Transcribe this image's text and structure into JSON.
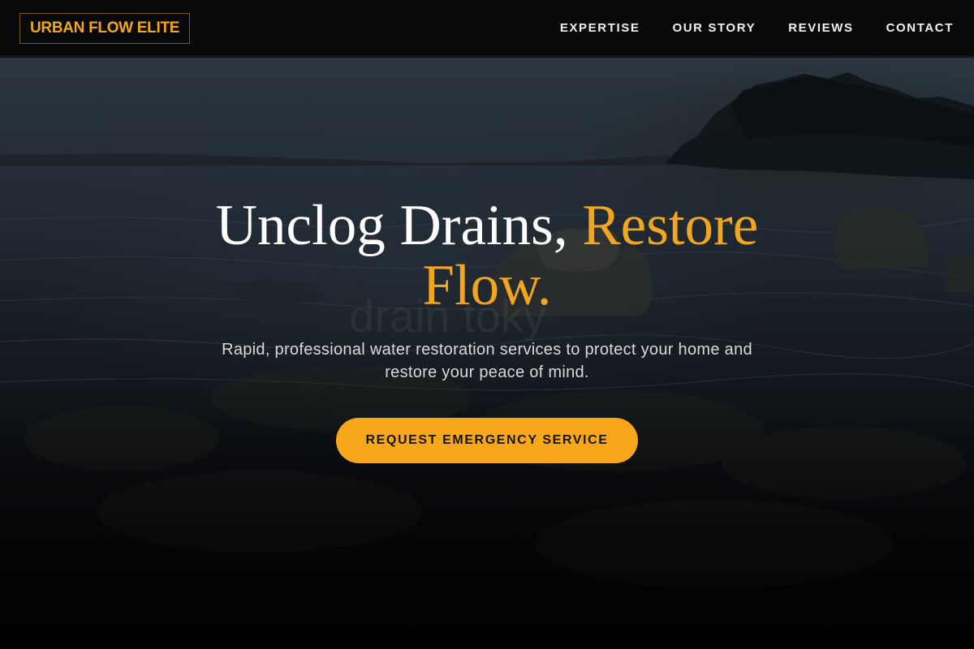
{
  "brand": {
    "name": "URBAN FLOW ELITE"
  },
  "nav": {
    "items": [
      {
        "label": "EXPERTISE"
      },
      {
        "label": "OUR STORY"
      },
      {
        "label": "REVIEWS"
      },
      {
        "label": "CONTACT"
      }
    ]
  },
  "hero": {
    "headline_main": "Unclog Drains, ",
    "headline_accent": "Restore Flow.",
    "subtext": "Rapid, professional water restoration services to protect your home and restore your peace of mind.",
    "cta_label": "REQUEST EMERGENCY SERVICE",
    "watermark": "drain toky"
  },
  "colors": {
    "accent": "#f2a51f",
    "button": "#f7a719",
    "header_bg": "#08090b",
    "text": "#ffffff"
  }
}
